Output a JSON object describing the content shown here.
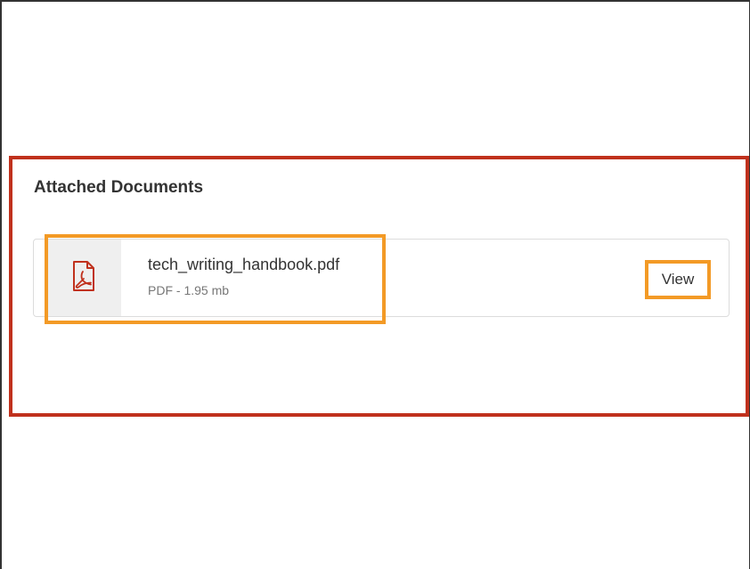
{
  "section": {
    "title": "Attached Documents"
  },
  "document": {
    "icon": "pdf-file-icon",
    "file_name": "tech_writing_handbook.pdf",
    "meta": "PDF - 1.95 mb",
    "view_label": "View"
  },
  "colors": {
    "section_highlight": "#c0311d",
    "item_highlight": "#f39a26",
    "pdf_icon": "#c0311d",
    "icon_background": "#efefef"
  }
}
